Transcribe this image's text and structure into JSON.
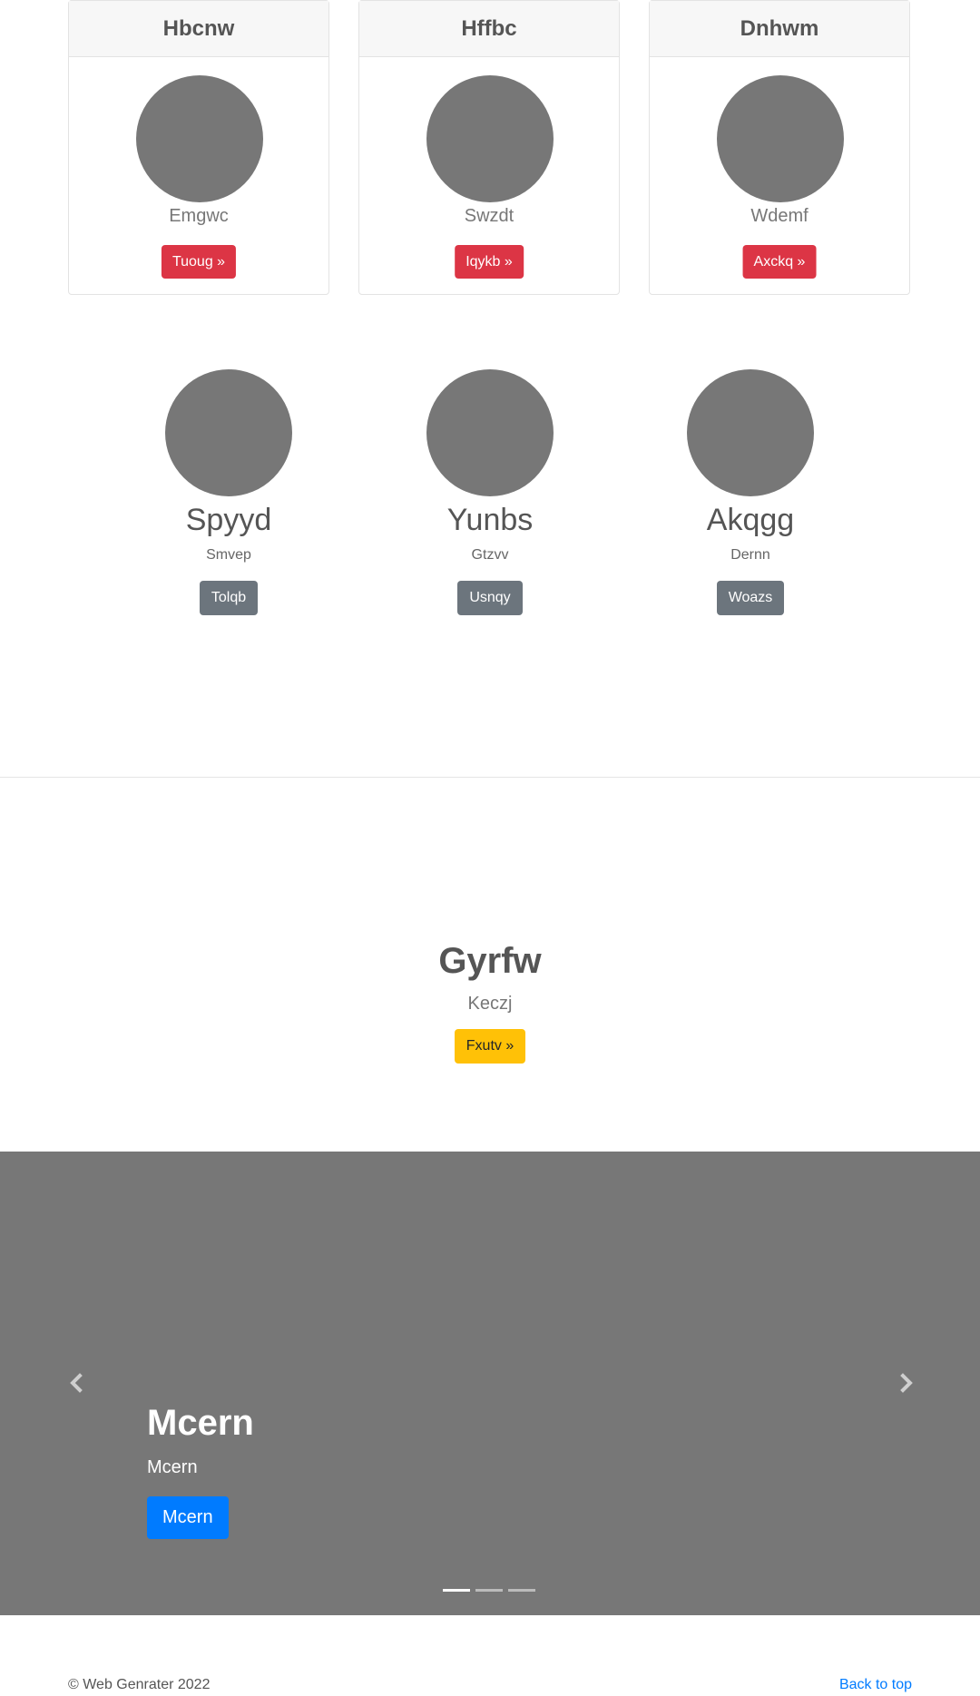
{
  "cards": [
    {
      "title": "Hbcnw",
      "subtitle": "Emgwc",
      "button": "Tuoug »"
    },
    {
      "title": "Hffbc",
      "subtitle": "Swzdt",
      "button": "Iqykb »"
    },
    {
      "title": "Dnhwm",
      "subtitle": "Wdemf",
      "button": "Axckq »"
    }
  ],
  "people": [
    {
      "name": "Spyyd",
      "role": "Smvep",
      "button": "Tolqb"
    },
    {
      "name": "Yunbs",
      "role": "Gtzvv",
      "button": "Usnqy"
    },
    {
      "name": "Akqgg",
      "role": "Dernn",
      "button": "Woazs"
    }
  ],
  "hero": {
    "title": "Gyrfw",
    "subtitle": "Keczj",
    "button": "Fxutv »"
  },
  "carousel": {
    "title": "Mcern",
    "subtitle": "Mcern",
    "button": "Mcern",
    "prev_icon": "chevron-left-icon",
    "next_icon": "chevron-right-icon",
    "indicators": 3,
    "active_indicator": 0
  },
  "footer": {
    "copyright": "© Web Genrater 2022",
    "back_to_top": "Back to top"
  },
  "colors": {
    "danger": "#dc3545",
    "secondary": "#6c757d",
    "warning": "#ffc107",
    "primary": "#007bff",
    "placeholder": "#777777"
  }
}
